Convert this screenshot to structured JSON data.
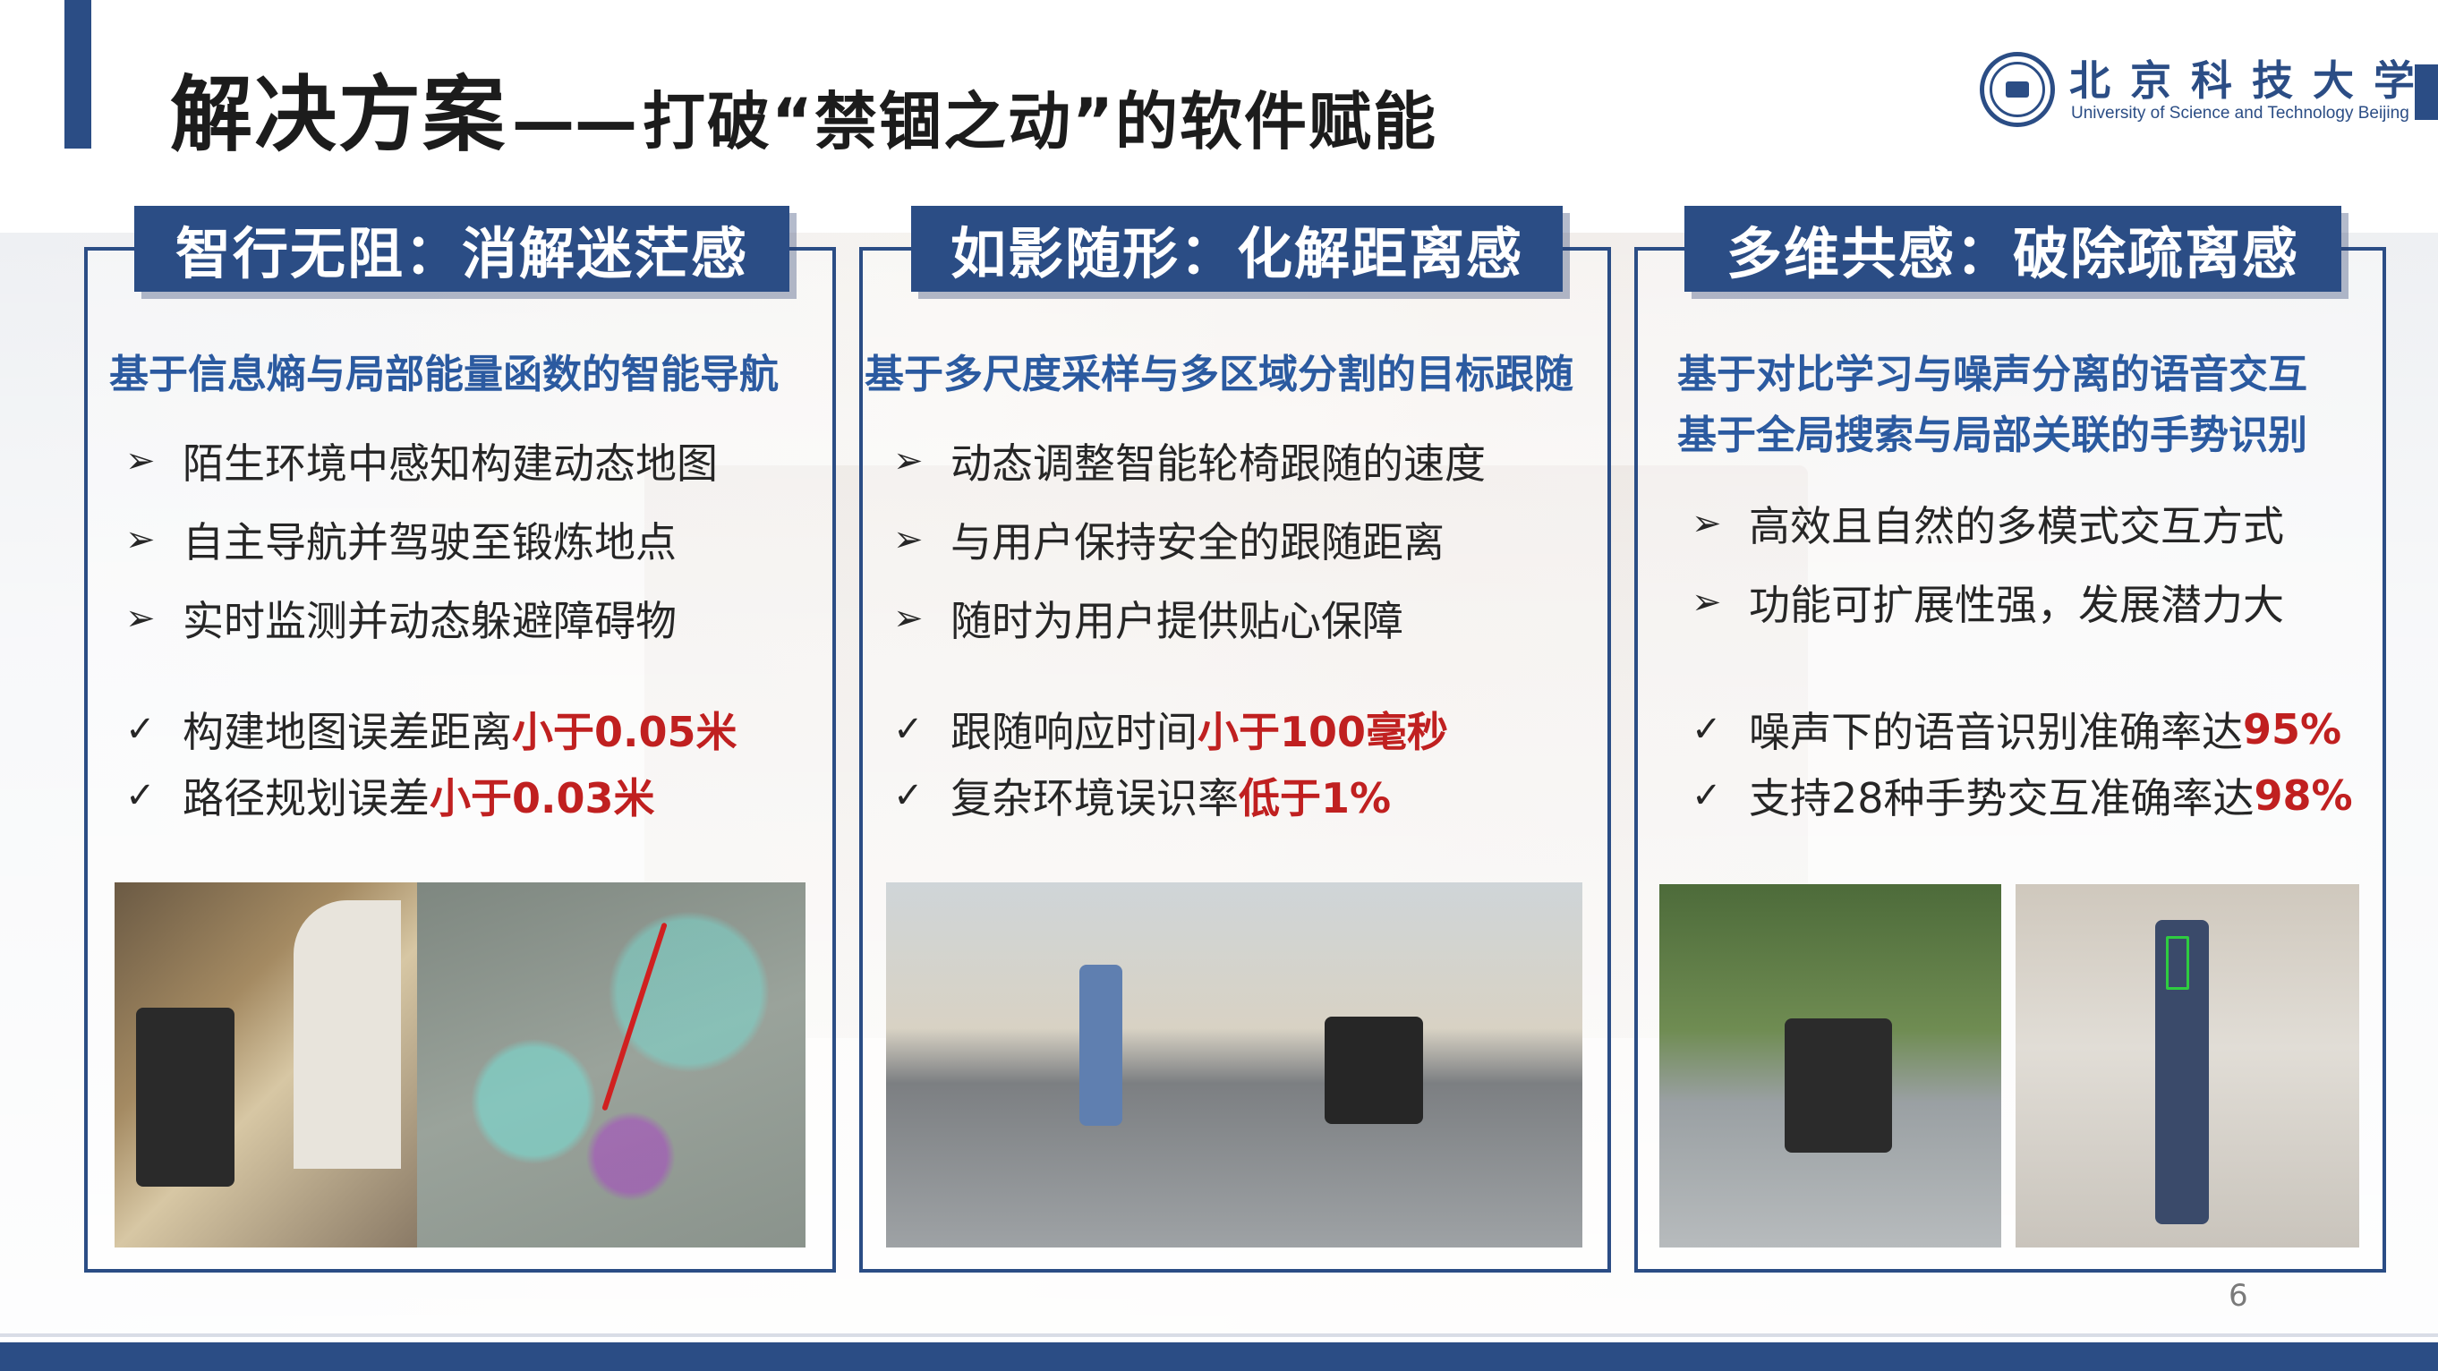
{
  "title": {
    "main": "解决方案",
    "dash": "——",
    "sub": "打破“禁锢之动”的软件赋能"
  },
  "logo": {
    "cn": "北京科技大学",
    "en": "University of Science and Technology Beijing"
  },
  "panels": [
    {
      "heading": "智行无阻：消解迷茫感",
      "subtitles": [
        "基于信息熵与局部能量函数的智能导航"
      ],
      "features": [
        "陌生环境中感知构建动态地图",
        "自主导航并驾驶至锻炼地点",
        "实时监测并动态躲避障碍物"
      ],
      "results": [
        {
          "text": "构建地图误差距离",
          "highlight": "小于0.05米"
        },
        {
          "text": "路径规划误差",
          "highlight": "小于0.03米"
        }
      ]
    },
    {
      "heading": "如影随形：化解距离感",
      "subtitles": [
        "基于多尺度采样与多区域分割的目标跟随"
      ],
      "features": [
        "动态调整智能轮椅跟随的速度",
        "与用户保持安全的跟随距离",
        "随时为用户提供贴心保障"
      ],
      "results": [
        {
          "text": "跟随响应时间",
          "highlight": "小于100毫秒"
        },
        {
          "text": "复杂环境误识率",
          "highlight": "低于1%"
        }
      ]
    },
    {
      "heading": "多维共感：破除疏离感",
      "subtitles": [
        "基于对比学习与噪声分离的语音交互",
        "基于全局搜索与局部关联的手势识别"
      ],
      "features": [
        "高效且自然的多模式交互方式",
        "功能可扩展性强，发展潜力大"
      ],
      "results": [
        {
          "text": "噪声下的语音识别准确率达",
          "highlight": "95%"
        },
        {
          "text": "支持28种手势交互准确率达",
          "highlight": "98%"
        }
      ]
    }
  ],
  "marks": {
    "feature": "➢",
    "result": "✓"
  },
  "page_number": "6",
  "colors": {
    "brand": "#2b4d85",
    "subtitle": "#2b5aa0",
    "highlight": "#c02020"
  }
}
